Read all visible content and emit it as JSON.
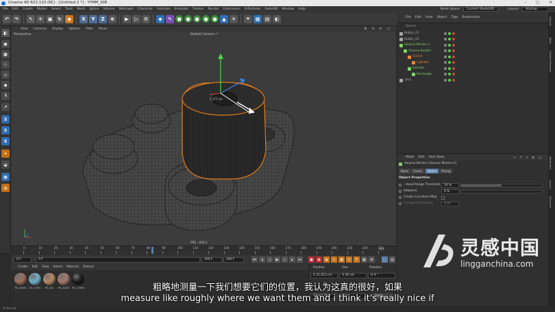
{
  "window": {
    "title": "Cinema 4D R22.110 (RC) - [Untitled 2 *] - YYMM_IOB",
    "controls": [
      "–",
      "□",
      "✕"
    ]
  },
  "menu": {
    "items": [
      "File",
      "Edit",
      "Create",
      "Modes",
      "Select",
      "Tools",
      "Mesh",
      "Spline",
      "Volume",
      "MoGraph",
      "Character",
      "Animate",
      "Simulate",
      "Tracker",
      "Render",
      "Extensions",
      "X-Particles",
      "Redshift",
      "Window",
      "Help"
    ],
    "node_space_label": "Node Space:",
    "node_space_value": "Current (Redshift)",
    "layout_label": "Layout:",
    "layout_value": "Startup"
  },
  "toolbar": {
    "axis": [
      "X",
      "Y",
      "Z"
    ]
  },
  "viewport": {
    "menu": [
      "View",
      "Cameras",
      "Display",
      "Options",
      "Filter",
      "Panel"
    ],
    "name": "Perspective",
    "camera": "Default Camera •°",
    "measure": "3.177 cm",
    "fps": "FPS : 436.1"
  },
  "timeline": {
    "ticks": [
      "0",
      "10",
      "20",
      "30",
      "40",
      "50",
      "60",
      "70",
      "80",
      "90",
      "100",
      "110",
      "120",
      "130",
      "140",
      "150",
      "160",
      "170",
      "180",
      "190",
      "200",
      "210",
      "220",
      "230"
    ],
    "end_label": "0 F",
    "start_field": "0 F",
    "current_field": "0 F",
    "end_field": "200 F",
    "max_field": "200 F"
  },
  "materials": {
    "menu": [
      "Create",
      "Edit",
      "View",
      "Select",
      "Material",
      "Texture"
    ],
    "items": [
      {
        "name": "RS_BASE",
        "color": "#9a6f5a"
      },
      {
        "name": "UV_CHEC",
        "color": "#6fb0c8"
      },
      {
        "name": "RS_BG",
        "color": "#b88a62"
      },
      {
        "name": "RS_BASE",
        "color": "#a6786a"
      },
      {
        "name": "RS_CONN",
        "color": "#1a1a1a"
      }
    ]
  },
  "coords": {
    "headers": [
      "Position",
      "Size",
      "Rotation"
    ],
    "x_pos": "X  21.613 cm",
    "x_size": "X  30 cm",
    "h_rot": "H  0 °",
    "mode_object": "Object (Rel)",
    "mode_size": "Size",
    "apply": "Apply"
  },
  "object_manager": {
    "menu": [
      "File",
      "Edit",
      "View",
      "Object",
      "Tags",
      "Bookmarks"
    ],
    "search_placeholder": "Search",
    "objects": [
      {
        "name": "Bobby_01",
        "indent": 0,
        "color": "#aaaaaa"
      },
      {
        "name": "Bobby_02",
        "indent": 0,
        "color": "#aaaaaa"
      },
      {
        "name": "Volume Mesher.1",
        "indent": 0,
        "color": "#7fd26a"
      },
      {
        "name": "Volume Builder",
        "indent": 1,
        "color": "#7fd26a"
      },
      {
        "name": "Carrier",
        "indent": 2,
        "color": "#e88a3b"
      },
      {
        "name": "Cylinder",
        "indent": 3,
        "color": "#e88a3b"
      },
      {
        "name": "Extrude",
        "indent": 2,
        "color": "#7fd26a"
      },
      {
        "name": "Rectangle",
        "indent": 3,
        "color": "#7fd26a"
      },
      {
        "name": ".png",
        "indent": 0,
        "color": "#aaaaaa"
      }
    ]
  },
  "attributes": {
    "menu": [
      "Mode",
      "Edit",
      "User Data"
    ],
    "title": "Volume Mesher [Volume Mesher.1]",
    "tabs": [
      "Basic",
      "Coord.",
      "Object",
      "Phong"
    ],
    "active_tab": "Object",
    "section": "Object Properties",
    "props": [
      {
        "label": "› Voxel Range Threshold",
        "value": "50 %",
        "fill": 0.5
      },
      {
        "label": "Adaptive",
        "value": "0 %",
        "fill": 0
      },
      {
        "label": "Create Curvature Map",
        "value": "",
        "fill": null
      },
      {
        "label": "Curvature Direction",
        "value": "Both",
        "fill": null
      }
    ]
  },
  "side_tabs": [
    "Objects",
    "Takes",
    "Content Browser",
    "Attributes",
    "Layers",
    "Structure"
  ],
  "status": "3.7m cm",
  "subtitles": {
    "cn": "粗略地测量一下我们想要它们的位置，我认为这真的很好，如果",
    "en": "measure like roughly where we want them and i think it's really nice if"
  },
  "watermark": {
    "cn": "灵感中国",
    "en": "lingganchina.com"
  }
}
